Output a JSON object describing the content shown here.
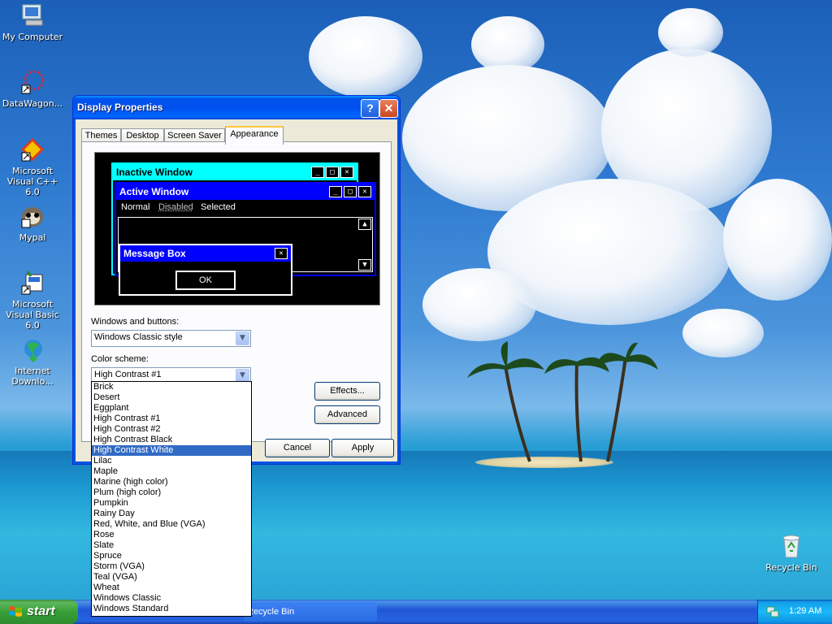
{
  "desktop_icons": [
    {
      "label": "My Computer",
      "icon": "my-computer-icon"
    },
    {
      "label": "DataWagon...",
      "icon": "datawagon-icon"
    },
    {
      "label": "Microsoft Visual C++ 6.0",
      "icon": "visual-cpp-icon"
    },
    {
      "label": "Mypal",
      "icon": "mypal-icon"
    },
    {
      "label": "Microsoft Visual Basic 6.0",
      "icon": "visual-basic-icon"
    },
    {
      "label": "Internet Downlo...",
      "icon": "internet-download-icon"
    },
    {
      "label": "Recycle Bin",
      "icon": "recycle-bin-icon"
    }
  ],
  "window": {
    "title": "Display Properties",
    "help_glyph": "?",
    "close_glyph": "✕",
    "tabs": [
      "Themes",
      "Desktop",
      "Screen Saver",
      "Appearance"
    ],
    "active_tab": "Appearance"
  },
  "preview": {
    "inactive_title": "Inactive Window",
    "active_title": "Active Window",
    "menu_normal": "Normal",
    "menu_disabled": "Disabled",
    "menu_selected": "Selected",
    "message_title": "Message Box",
    "ok_label": "OK",
    "colors": {
      "inactive": "#00ffff",
      "active": "#0000ff",
      "background": "#000000"
    }
  },
  "form": {
    "windows_buttons_label": "Windows and buttons:",
    "windows_buttons_value": "Windows Classic style",
    "color_scheme_label": "Color scheme:",
    "color_scheme_value": "High Contrast #1",
    "effects_label": "Effects...",
    "advanced_label": "Advanced",
    "cancel_label": "Cancel",
    "apply_label": "Apply"
  },
  "color_scheme_options": [
    "Brick",
    "Desert",
    "Eggplant",
    "High Contrast #1",
    "High Contrast #2",
    "High Contrast Black",
    "High Contrast White",
    "Lilac",
    "Maple",
    "Marine (high color)",
    "Plum (high color)",
    "Pumpkin",
    "Rainy Day",
    "Red, White, and Blue (VGA)",
    "Rose",
    "Slate",
    "Spruce",
    "Storm (VGA)",
    "Teal (VGA)",
    "Wheat",
    "Windows Classic",
    "Windows Standard"
  ],
  "highlighted_option": "High Contrast White",
  "taskbar": {
    "start_label": "start",
    "task_item_label": "Recycle Bin",
    "clock": "1:29 AM"
  }
}
